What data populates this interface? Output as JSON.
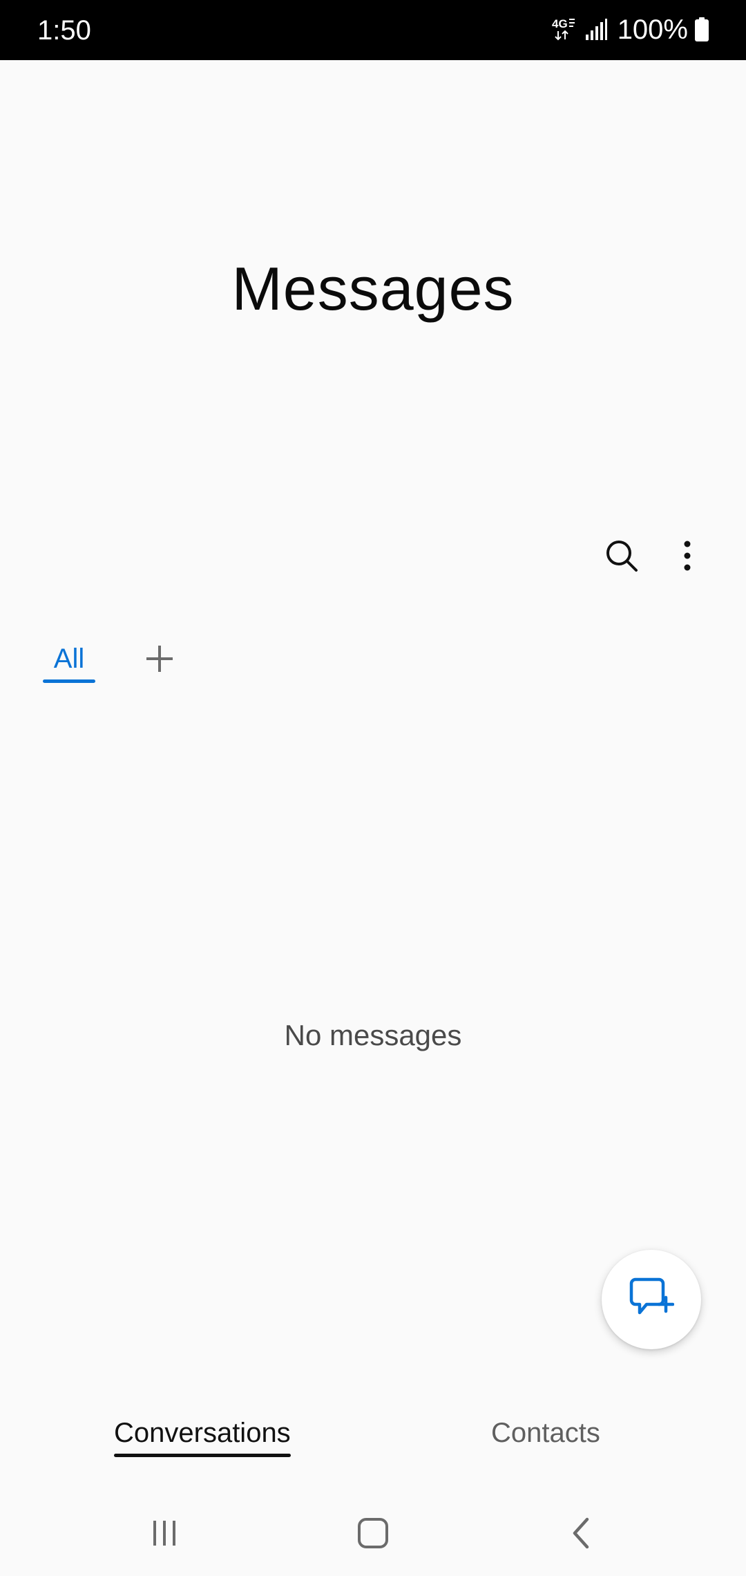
{
  "status_bar": {
    "time": "1:50",
    "network_type": "4G",
    "battery_percent": "100%",
    "icons": [
      "4g-lte-icon",
      "signal-strength-icon",
      "battery-icon"
    ]
  },
  "header": {
    "title": "Messages"
  },
  "toolbar": {
    "icons": [
      "search-icon",
      "more-options-icon"
    ]
  },
  "filter_tabs": {
    "items": [
      {
        "label": "All",
        "selected": true
      }
    ],
    "add_icon": "plus-icon"
  },
  "main": {
    "empty_state": "No messages"
  },
  "fab": {
    "icon": "new-message-icon"
  },
  "bottom_tabs": {
    "items": [
      {
        "label": "Conversations",
        "selected": true
      },
      {
        "label": "Contacts",
        "selected": false
      }
    ]
  },
  "nav_bar": {
    "icons": [
      "recents-icon",
      "home-icon",
      "back-icon"
    ]
  },
  "colors": {
    "accent": "#0a73d6",
    "background": "#fafafa",
    "status_bar": "#000000",
    "text_primary": "#111111",
    "text_secondary": "#5f5f5f"
  }
}
